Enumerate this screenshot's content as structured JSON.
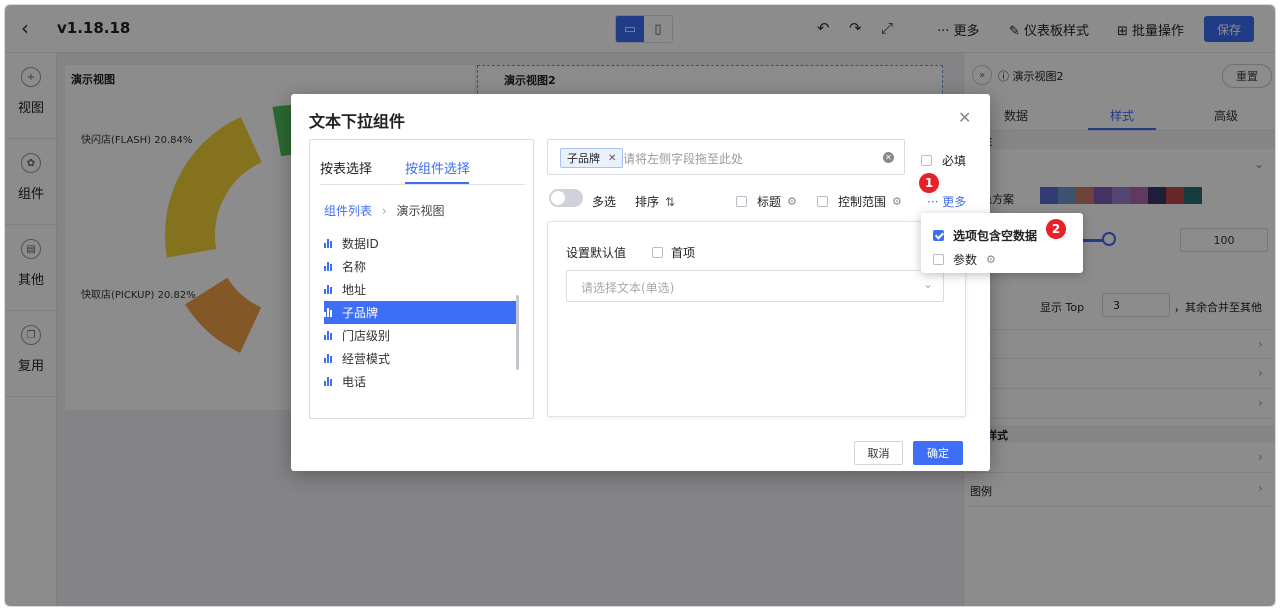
{
  "topbar": {
    "version": "v1.18.18",
    "more": "更多",
    "dashboard_style": "仪表板样式",
    "batch_ops": "批量操作",
    "save": "保存"
  },
  "left_sidebar": {
    "items": [
      {
        "label": "视图",
        "icon": "plus-circle-icon"
      },
      {
        "label": "组件",
        "icon": "gear-circle-icon"
      },
      {
        "label": "其他",
        "icon": "box-icon"
      },
      {
        "label": "复用",
        "icon": "copy-icon"
      }
    ]
  },
  "canvas": {
    "panel1_title": "演示视图",
    "panel2_title": "演示视图2",
    "pie_labels": [
      "快闪店(FLASH) 20.84%",
      "快取店(PICKUP) 20.82%"
    ]
  },
  "right_sidebar": {
    "title": "演示视图2",
    "reset": "重置",
    "tabs": [
      "数据",
      "样式",
      "高级"
    ],
    "section_attr": "属性",
    "color_scheme": "配色方案",
    "palette": [
      "#5b6ed1",
      "#7095c9",
      "#c97b6e",
      "#7c5bb8",
      "#9a7fd0",
      "#b06aa8",
      "#3a3868",
      "#c0464c",
      "#236f73"
    ],
    "value_100": "100",
    "show_top": "显示  Top",
    "top_value": "3",
    "merge_rest": "，其余合并至其他",
    "section_style": "样式",
    "legend": "图例"
  },
  "dialog": {
    "title": "文本下拉组件",
    "tabs": [
      "按表选择",
      "按组件选择"
    ],
    "breadcrumb": {
      "root": "组件列表",
      "current": "演示视图"
    },
    "fields": [
      "数据ID",
      "名称",
      "地址",
      "子品牌",
      "门店级别",
      "经营模式",
      "电话"
    ],
    "selected_field": "子品牌",
    "field_box": {
      "tag": "子品牌",
      "placeholder": "请将左侧字段拖至此处"
    },
    "required": "必填",
    "multi": "多选",
    "sort": "排序",
    "title_opt": "标题",
    "range_opt": "控制范围",
    "more": "··· 更多",
    "default_label": "设置默认值",
    "first_item": "首项",
    "select_placeholder": "请选择文本(单选)",
    "cancel": "取消",
    "ok": "确定"
  },
  "popover": {
    "items": [
      {
        "label": "选项包含空数据",
        "checked": true
      },
      {
        "label": "参数",
        "checked": false
      }
    ]
  },
  "badges": [
    "1",
    "2"
  ]
}
